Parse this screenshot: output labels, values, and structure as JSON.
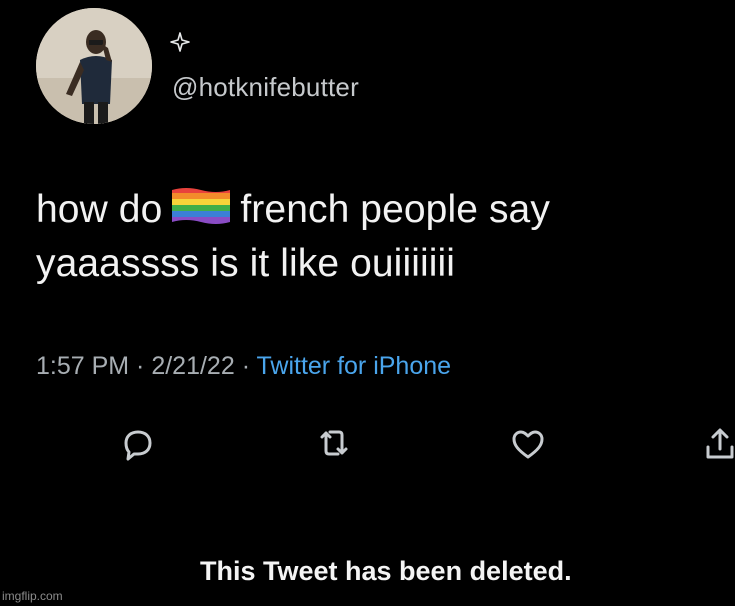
{
  "tweet": {
    "handle": "@hotknifebutter",
    "text_line1_before": "how do",
    "text_line1_after": "french people say",
    "text_line2": "yaaassss is it like ouiiiiiii",
    "time": "1:57 PM",
    "separator1": " · ",
    "date": "2/21/22",
    "separator2": " · ",
    "source": "Twitter for iPhone",
    "deleted_notice": "This Tweet has been deleted."
  },
  "icons": {
    "verified_sparkle": "sparkle-icon",
    "inline_emoji": "rainbow-flag-icon",
    "reply": "reply-icon",
    "retweet": "retweet-icon",
    "like": "heart-icon",
    "share": "share-icon"
  },
  "colors": {
    "background": "#000000",
    "text": "#f2f2f2",
    "muted": "#a8aeb3",
    "link": "#4aa5ec"
  },
  "watermark": "imgflip.com"
}
